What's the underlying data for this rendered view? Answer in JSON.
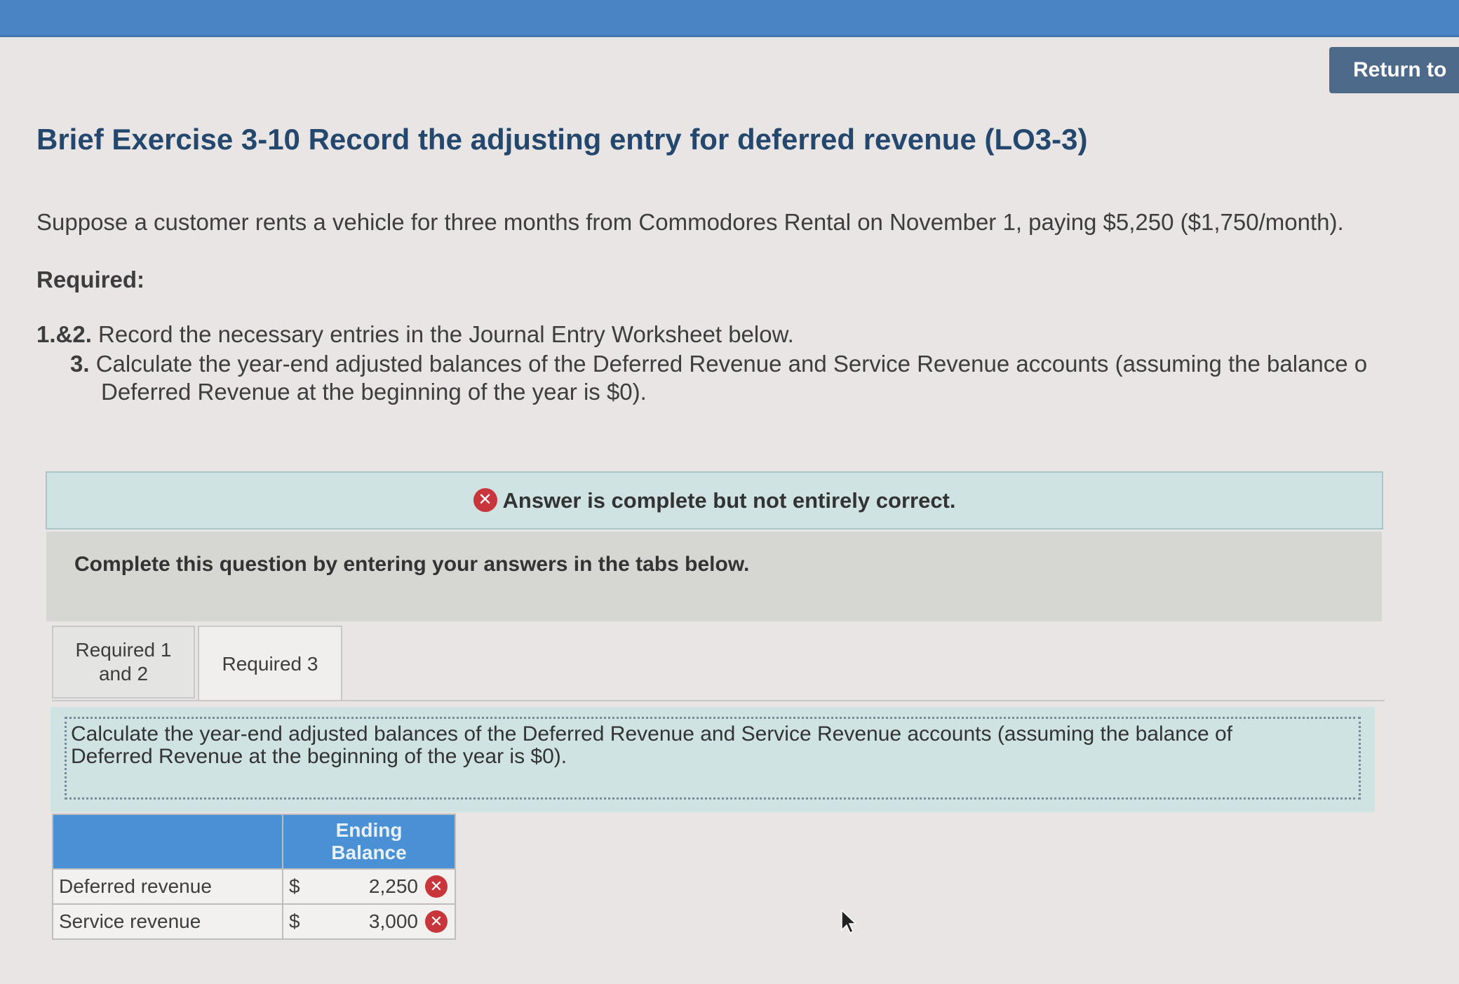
{
  "header": {
    "return_label": "Return to"
  },
  "exercise": {
    "title": "Brief Exercise 3-10 Record the adjusting entry for deferred revenue (LO3-3)",
    "intro": "Suppose a customer rents a vehicle for three months from Commodores Rental on November 1, paying $5,250 ($1,750/month).",
    "required_label": "Required:",
    "requirements": [
      {
        "number": "1.&2.",
        "text": "Record the necessary entries in the Journal Entry Worksheet below."
      },
      {
        "number": "3.",
        "text": "Calculate the year-end adjusted balances of the Deferred Revenue and Service Revenue accounts (assuming the balance o",
        "text_line2": "Deferred Revenue at the beginning of the year is $0)."
      }
    ]
  },
  "feedback": {
    "icon": "x-circle-icon",
    "message": "Answer is complete but not entirely correct."
  },
  "instruction": "Complete this question by entering your answers in the tabs below.",
  "tabs": [
    {
      "label_line1": "Required 1",
      "label_line2": "and 2",
      "active": false
    },
    {
      "label": "Required 3",
      "active": true
    }
  ],
  "prompt": {
    "line1": "Calculate the year-end adjusted balances of the Deferred Revenue and Service Revenue accounts (assuming the balance of",
    "line2": "Deferred Revenue at the beginning of the year is $0)."
  },
  "table": {
    "header_line1": "Ending",
    "header_line2": "Balance",
    "rows": [
      {
        "label": "Deferred revenue",
        "currency": "$",
        "value": "2,250",
        "status": "incorrect"
      },
      {
        "label": "Service revenue",
        "currency": "$",
        "value": "3,000",
        "status": "incorrect"
      }
    ]
  },
  "colors": {
    "topbar": "#4a84c4",
    "title": "#24476e",
    "feedback_bg": "#cfe3e3",
    "table_header": "#4a90d4",
    "error": "#c8353a"
  }
}
